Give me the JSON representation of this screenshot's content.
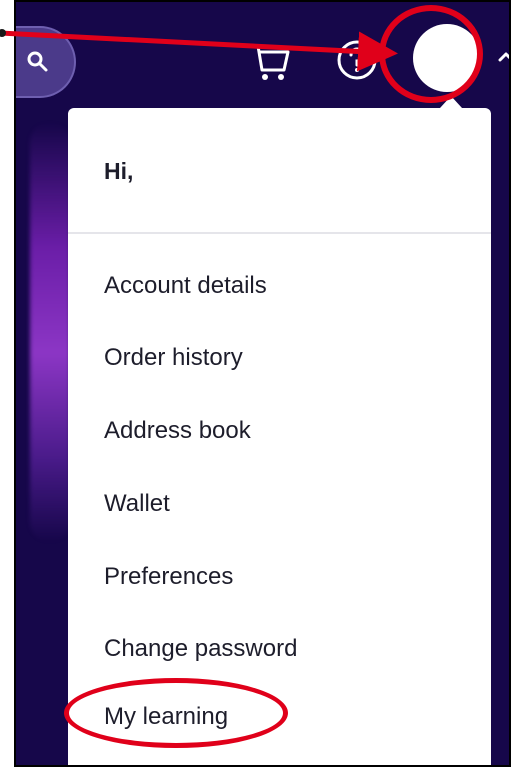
{
  "header": {
    "icons": {
      "search": "search-icon",
      "cart": "cart-icon",
      "help": "help-icon",
      "avatar": "avatar",
      "chevron": "chevron-up-icon"
    },
    "colors": {
      "background": "#16074a",
      "highlight": "#e0001a",
      "menu_bg": "#ffffff",
      "text": "#1d1d2b"
    }
  },
  "menu": {
    "greeting": "Hi,",
    "items": [
      {
        "label": "Account details"
      },
      {
        "label": "Order history"
      },
      {
        "label": "Address book"
      },
      {
        "label": "Wallet"
      },
      {
        "label": "Preferences"
      },
      {
        "label": "Change password"
      },
      {
        "label": "My learning"
      }
    ]
  }
}
